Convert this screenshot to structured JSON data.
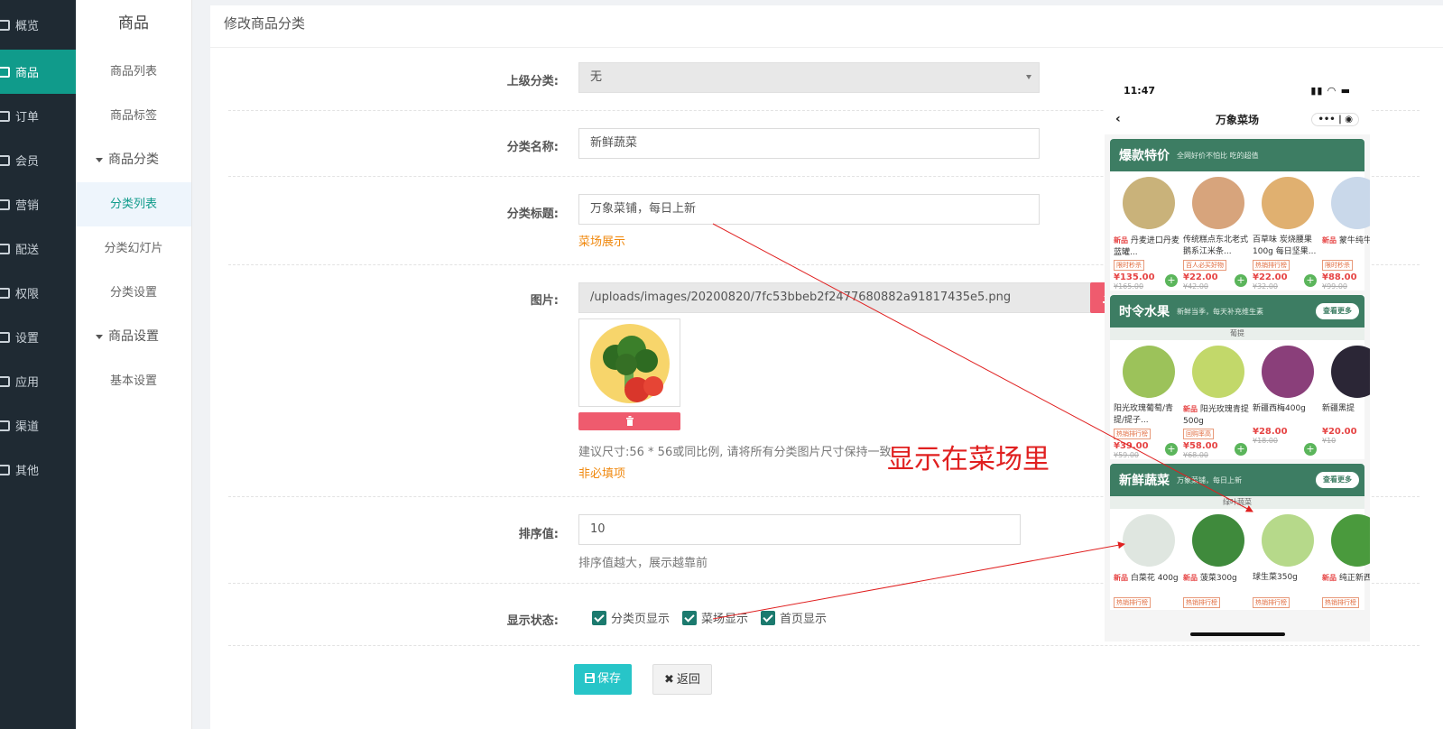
{
  "nav": [
    {
      "label": "概览",
      "active": false
    },
    {
      "label": "商品",
      "active": true
    },
    {
      "label": "订单",
      "active": false
    },
    {
      "label": "会员",
      "active": false
    },
    {
      "label": "营销",
      "active": false
    },
    {
      "label": "配送",
      "active": false
    },
    {
      "label": "权限",
      "active": false
    },
    {
      "label": "设置",
      "active": false
    },
    {
      "label": "应用",
      "active": false
    },
    {
      "label": "渠道",
      "active": false
    },
    {
      "label": "其他",
      "active": false
    }
  ],
  "subnav": {
    "title": "商品",
    "items": [
      "商品列表",
      "商品标签"
    ],
    "group1": "商品分类",
    "group1_items": [
      "分类列表",
      "分类幻灯片",
      "分类设置"
    ],
    "group2": "商品设置",
    "group2_items": [
      "基本设置"
    ]
  },
  "page_title": "修改商品分类",
  "form": {
    "parent_label": "上级分类:",
    "parent_value": "无",
    "name_label": "分类名称:",
    "name_value": "新鲜蔬菜",
    "subtitle_label": "分类标题:",
    "subtitle_value": "万象菜铺，每日上新",
    "subtitle_hint": "菜场展示",
    "image_label": "图片:",
    "image_value": "/uploads/images/20200820/7fc53bbeb2f2477680882a91817435e5.png",
    "image_hint": "建议尺寸:56 * 56或同比例, 请将所有分类图片尺寸保持一致",
    "image_optional": "非必填项",
    "sort_label": "排序值:",
    "sort_value": "10",
    "sort_hint": "排序值越大，展示越靠前",
    "status_label": "显示状态:",
    "status_options": [
      "分类页显示",
      "菜场显示",
      "首页显示"
    ],
    "save_label": "保存",
    "back_label": "返回"
  },
  "annotation": "显示在菜场里",
  "phone": {
    "time": "11:47",
    "title": "万象菜场",
    "sections": [
      {
        "title": "爆款特价",
        "subtitle": "全网好价不怕比 吃的超值",
        "more": "",
        "tab": "",
        "products": [
          {
            "tag": "新品",
            "name": "丹麦进口丹麦蓝罐...",
            "badge": "限时秒杀",
            "price": "¥135.00",
            "old": "¥165.00",
            "color": "#c9b27a"
          },
          {
            "tag": "",
            "name": "传统糕点东北老式鹅系江米条...",
            "badge": "百人必买好物",
            "price": "¥22.00",
            "old": "¥42.00",
            "color": "#d7a47c"
          },
          {
            "tag": "",
            "name": "百草味 炭烧腰果100g 每日坚果...",
            "badge": "热销排行榜",
            "price": "¥22.00",
            "old": "¥32.00",
            "color": "#e0b070"
          },
          {
            "tag": "新品",
            "name": "蒙牛纯牛奶...",
            "badge": "限时秒杀",
            "price": "¥88.00",
            "old": "¥99.00",
            "color": "#c9d8ea"
          }
        ]
      },
      {
        "title": "时令水果",
        "subtitle": "新鲜当季，每天补充维生素",
        "more": "查看更多",
        "tab": "葡提",
        "products": [
          {
            "tag": "",
            "name": "阳光玫瑰葡萄/青提/提子...",
            "badge": "热销排行榜",
            "price": "¥39.00",
            "old": "¥59.00",
            "color": "#9cc25a"
          },
          {
            "tag": "新品",
            "name": "阳光玫瑰青提500g",
            "badge": "回购率高",
            "price": "¥58.00",
            "old": "¥68.00",
            "color": "#c2d86a"
          },
          {
            "tag": "",
            "name": "新疆西梅400g",
            "badge": "",
            "price": "¥28.00",
            "old": "¥18.00",
            "color": "#8a3f7a"
          },
          {
            "tag": "",
            "name": "新疆黑提",
            "badge": "",
            "price": "¥20.00",
            "old": "¥10",
            "color": "#2b2636"
          }
        ]
      },
      {
        "title": "新鲜蔬菜",
        "subtitle": "万象菜铺，每日上新",
        "more": "查看更多",
        "tab": "绿叶蔬菜",
        "products": [
          {
            "tag": "新品",
            "name": "白菜花 400g",
            "badge": "热销排行榜",
            "price": "",
            "old": "",
            "color": "#dfe6e0"
          },
          {
            "tag": "新品",
            "name": "菠菜300g",
            "badge": "热销排行榜",
            "price": "",
            "old": "",
            "color": "#3f8a3c"
          },
          {
            "tag": "",
            "name": "球生菜350g",
            "badge": "热销排行榜",
            "price": "",
            "old": "",
            "color": "#b6d98a"
          },
          {
            "tag": "新品",
            "name": "纯正新西...",
            "badge": "热销排行榜",
            "price": "",
            "old": "",
            "color": "#4a9a3d"
          }
        ]
      }
    ]
  },
  "colors": {
    "accent": "#109b8b",
    "nav_bg": "#1f2a33",
    "save": "#27c5c8",
    "danger": "#ef5b6e",
    "orange": "#f0890f",
    "annotation": "#e02020"
  }
}
